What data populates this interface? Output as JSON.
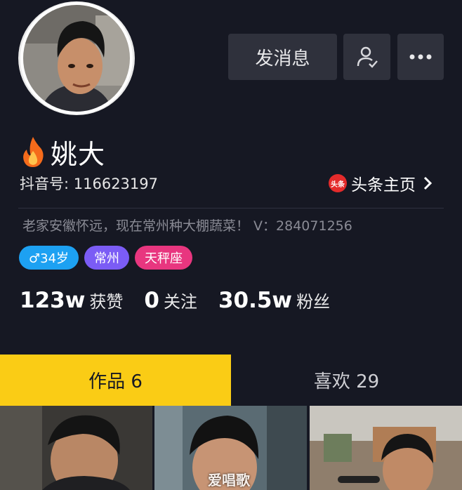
{
  "profile": {
    "name": "姚大",
    "id_label": "抖音号: 116623197",
    "bio": "老家安徽怀远，现在常州种大棚蔬菜！ V：284071256",
    "toutiao_label": "头条主页",
    "toutiao_badge": "头条"
  },
  "actions": {
    "message_label": "发消息",
    "follow_icon": "person-check-icon",
    "more_icon": "more-icon"
  },
  "tags": [
    {
      "label": "♂34岁",
      "color": "#1da1f2"
    },
    {
      "label": "常州",
      "color": "#7b5cf5"
    },
    {
      "label": "天秤座",
      "color": "#e8367f"
    }
  ],
  "stats": [
    {
      "value": "123w",
      "label": "获赞"
    },
    {
      "value": "0",
      "label": "关注"
    },
    {
      "value": "30.5w",
      "label": "粉丝"
    }
  ],
  "tabs": {
    "works": "作品 6",
    "likes": "喜欢 29"
  },
  "watermark": "爱唱歌",
  "colors": {
    "background": "#161823",
    "accent": "#facc15"
  }
}
